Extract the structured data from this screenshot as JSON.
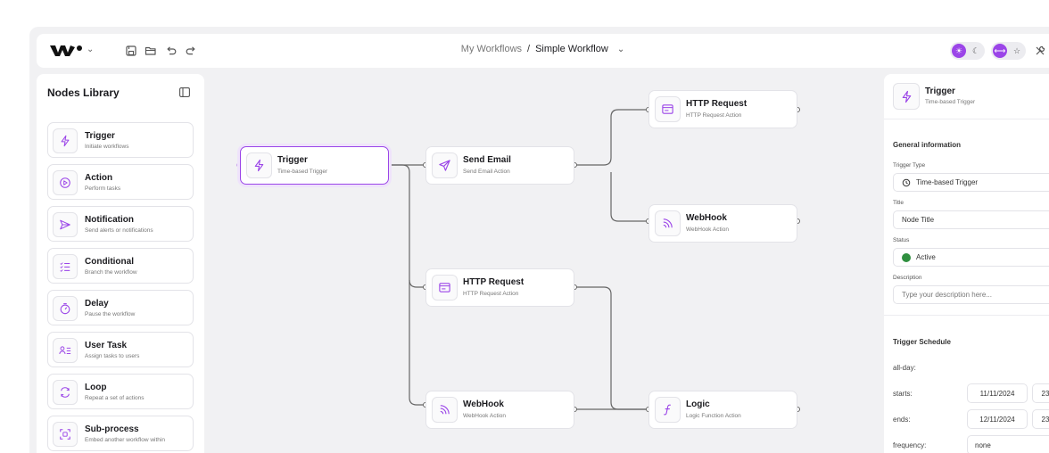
{
  "header": {
    "breadcrumb_parent": "My Workflows",
    "breadcrumb_sep": "/",
    "breadcrumb_current": "Simple Workflow"
  },
  "library": {
    "title": "Nodes Library",
    "items": [
      {
        "name": "Trigger",
        "desc": "Initiate workflows",
        "icon": "bolt-icon"
      },
      {
        "name": "Action",
        "desc": "Perform tasks",
        "icon": "play-circle-icon"
      },
      {
        "name": "Notification",
        "desc": "Send alerts or notifications",
        "icon": "send-icon"
      },
      {
        "name": "Conditional",
        "desc": "Branch the workflow",
        "icon": "list-check-icon"
      },
      {
        "name": "Delay",
        "desc": "Pause the workflow",
        "icon": "timer-icon"
      },
      {
        "name": "User Task",
        "desc": "Assign tasks to users",
        "icon": "user-list-icon"
      },
      {
        "name": "Loop",
        "desc": "Repeat a set of actions",
        "icon": "loop-icon"
      },
      {
        "name": "Sub-process",
        "desc": "Embed another workflow within",
        "icon": "frame-icon"
      }
    ]
  },
  "canvas": {
    "nodes": [
      {
        "id": "trigger",
        "title": "Trigger",
        "sub": "Time-based Trigger",
        "icon": "bolt-icon",
        "selected": true
      },
      {
        "id": "send-email",
        "title": "Send Email",
        "sub": "Send Email Action",
        "icon": "send-icon"
      },
      {
        "id": "http-request-1",
        "title": "HTTP Request",
        "sub": "HTTP Request Action",
        "icon": "window-icon"
      },
      {
        "id": "webhook-1",
        "title": "WebHook",
        "sub": "WebHook Action",
        "icon": "rss-icon"
      },
      {
        "id": "http-request-2",
        "title": "HTTP Request",
        "sub": "HTTP Request Action",
        "icon": "window-icon"
      },
      {
        "id": "webhook-2",
        "title": "WebHook",
        "sub": "WebHook Action",
        "icon": "rss-icon"
      },
      {
        "id": "logic",
        "title": "Logic",
        "sub": "Logic Function Action",
        "icon": "function-icon"
      }
    ]
  },
  "panel": {
    "title": "Trigger",
    "subtitle": "Time-based Trigger",
    "general_heading": "General information",
    "trigger_type_label": "Trigger Type",
    "trigger_type_value": "Time-based Trigger",
    "title_label": "Title",
    "title_value": "Node Title",
    "status_label": "Status",
    "status_value": "Active",
    "description_label": "Description",
    "description_placeholder": "Type your description here...",
    "schedule_heading": "Trigger Schedule",
    "all_day_label": "all-day:",
    "starts_label": "starts:",
    "starts_date": "11/11/2024",
    "starts_time": "23",
    "ends_label": "ends:",
    "ends_date": "12/11/2024",
    "ends_time": "23",
    "frequency_label": "frequency:",
    "frequency_value": "none"
  },
  "colors": {
    "accent": "#9b45e8",
    "status_active": "#2f8f3f",
    "canvas_bg": "#f1f1f3"
  }
}
